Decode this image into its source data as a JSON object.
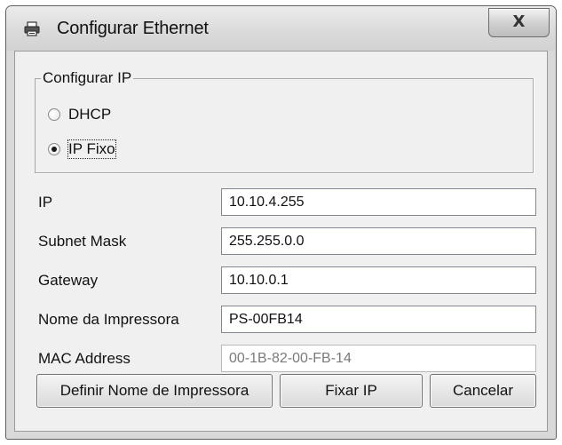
{
  "window": {
    "title": "Configurar Ethernet",
    "close_label": "X"
  },
  "ip_group": {
    "legend": "Configurar IP",
    "options": [
      {
        "label": "DHCP",
        "selected": false
      },
      {
        "label": "IP Fixo",
        "selected": true
      }
    ]
  },
  "fields": {
    "ip": {
      "label": "IP",
      "value": "10.10.4.255"
    },
    "subnet": {
      "label": "Subnet Mask",
      "value": "255.255.0.0"
    },
    "gateway": {
      "label": "Gateway",
      "value": "10.10.0.1"
    },
    "printer_name": {
      "label": "Nome da Impressora",
      "value": "PS-00FB14"
    },
    "mac": {
      "label": "MAC Address",
      "value": "00-1B-82-00-FB-14",
      "disabled": true
    }
  },
  "buttons": {
    "set_name": "Definir Nome de Impressora",
    "fix_ip": "Fixar IP",
    "cancel": "Cancelar"
  }
}
